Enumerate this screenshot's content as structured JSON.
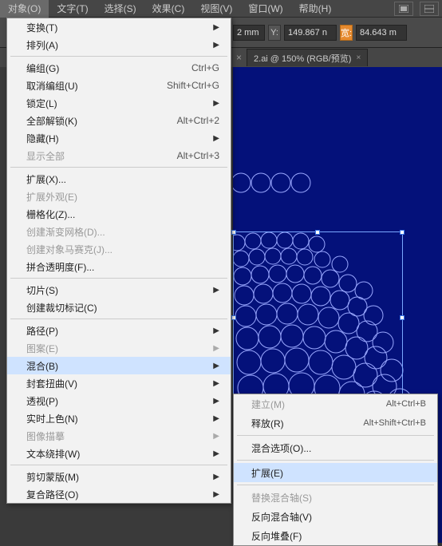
{
  "menubar": {
    "items": [
      "对象(O)",
      "文字(T)",
      "选择(S)",
      "效果(C)",
      "视图(V)",
      "窗口(W)",
      "帮助(H)"
    ]
  },
  "toolbar": {
    "x_suffix": "2 mm",
    "y_label": "Y:",
    "y_value": "149.867 n",
    "w_label": "宽:",
    "w_value": "84.643 m"
  },
  "tabs": {
    "hidden_close": "×",
    "active": {
      "label": "2.ai @ 150% (RGB/预览)",
      "close": "×"
    }
  },
  "menu": {
    "transform": "变换(T)",
    "arrange": "排列(A)",
    "group": "编组(G)",
    "group_sc": "Ctrl+G",
    "ungroup": "取消编组(U)",
    "ungroup_sc": "Shift+Ctrl+G",
    "lock": "锁定(L)",
    "unlockall": "全部解锁(K)",
    "unlockall_sc": "Alt+Ctrl+2",
    "hide": "隐藏(H)",
    "showall": "显示全部",
    "showall_sc": "Alt+Ctrl+3",
    "expand": "扩展(X)...",
    "expandapp": "扩展外观(E)",
    "rasterize": "栅格化(Z)...",
    "gradientmesh": "创建渐变网格(D)...",
    "mosaic": "创建对象马赛克(J)...",
    "flatten": "拼合透明度(F)...",
    "slice": "切片(S)",
    "trimmarks": "创建裁切标记(C)",
    "path": "路径(P)",
    "pattern": "图案(E)",
    "blend": "混合(B)",
    "envelope": "封套扭曲(V)",
    "perspective": "透视(P)",
    "livepaint": "实时上色(N)",
    "imagetrace": "图像描摹",
    "textwrap": "文本绕排(W)",
    "clipmask": "剪切蒙版(M)",
    "compound": "复合路径(O)"
  },
  "submenu": {
    "make": "建立(M)",
    "make_sc": "Alt+Ctrl+B",
    "release": "释放(R)",
    "release_sc": "Alt+Shift+Ctrl+B",
    "options": "混合选项(O)...",
    "expand": "扩展(E)",
    "replacespine": "替换混合轴(S)",
    "reversespine": "反向混合轴(V)",
    "reversefb": "反向堆叠(F)"
  }
}
